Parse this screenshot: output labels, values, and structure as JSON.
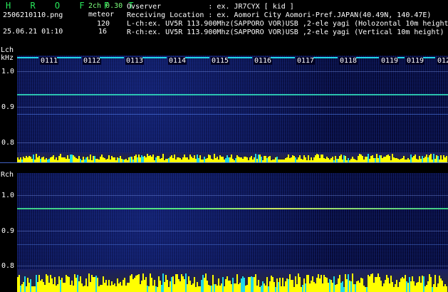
{
  "header": {
    "logo": "H R O F F T",
    "version_prefix": "2ch ",
    "version": "0.30",
    "filename": "2506210110.png",
    "datetime": "25.06.21 01:10",
    "meteor_label": "meteor",
    "count_l": "120",
    "count_r": "16",
    "observer": "Ovserver           : ex. JR7CYX [ kid ]",
    "location": "Receiving Location : ex. Aomori City Aomori-Pref.JAPAN(40.49N, 140.47E)",
    "lch_info": "L-ch:ex. UV5R 113.900Mhz(SAPPORO VOR)USB ,2-ele yagi (Holozontal 10m height)",
    "rch_info": "R-ch:ex. UV5R 113.900Mhz(SAPPORO VOR)USB ,2-ele yagi (Vertical 10m height)"
  },
  "lch": {
    "label": "Lch",
    "unit": "kHz",
    "ticks": [
      "1.0",
      "0.9",
      "0.8"
    ]
  },
  "rch": {
    "label": "Rch",
    "ticks": [
      "1.0",
      "0.9",
      "0.8"
    ]
  },
  "time_labels": [
    "0111",
    "0112",
    "0113",
    "0114",
    "0115",
    "0116",
    "0117",
    "0118",
    "0119",
    "0119",
    "012"
  ],
  "colors": {
    "signal_line": "#30e0c0",
    "signal_line_r": "#50f080",
    "level_bar": "#ffff00",
    "level_base": "#20d8e8",
    "logo": "#27e85a"
  }
}
